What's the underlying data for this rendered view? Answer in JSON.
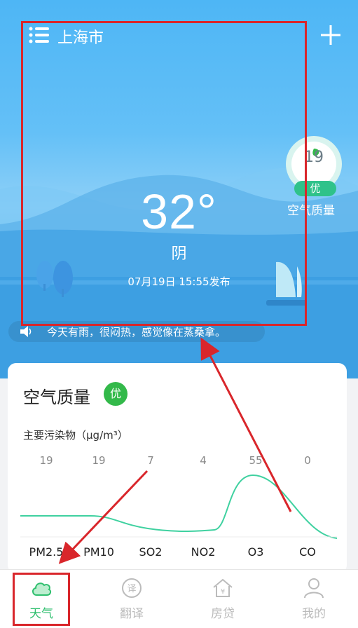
{
  "header": {
    "city": "上海市"
  },
  "weather": {
    "temperature": "32°",
    "condition": "阴",
    "published": "07月19日 15:55发布"
  },
  "aqi_badge": {
    "value": "19",
    "level": "优",
    "caption": "空气质量"
  },
  "notice": {
    "text": "今天有雨，很闷热，感觉像在蒸桑拿。"
  },
  "air_card": {
    "title": "空气质量",
    "level": "优",
    "pollutant_label": "主要污染物（μg/m³）",
    "pollutants": [
      {
        "name": "PM2.5",
        "value": "19"
      },
      {
        "name": "PM10",
        "value": "19"
      },
      {
        "name": "SO2",
        "value": "7"
      },
      {
        "name": "NO2",
        "value": "4"
      },
      {
        "name": "O3",
        "value": "55"
      },
      {
        "name": "CO",
        "value": "0"
      }
    ],
    "line_color": "#3fd1a0"
  },
  "tabs": [
    {
      "label": "天气",
      "icon": "cloud-icon",
      "active": true
    },
    {
      "label": "翻译",
      "icon": "translate-icon",
      "active": false
    },
    {
      "label": "房贷",
      "icon": "house-loan-icon",
      "active": false
    },
    {
      "label": "我的",
      "icon": "profile-icon",
      "active": false
    }
  ],
  "colors": {
    "accent": "#2fbf6e",
    "annotation": "#d9262b",
    "good": "#33b94a"
  }
}
